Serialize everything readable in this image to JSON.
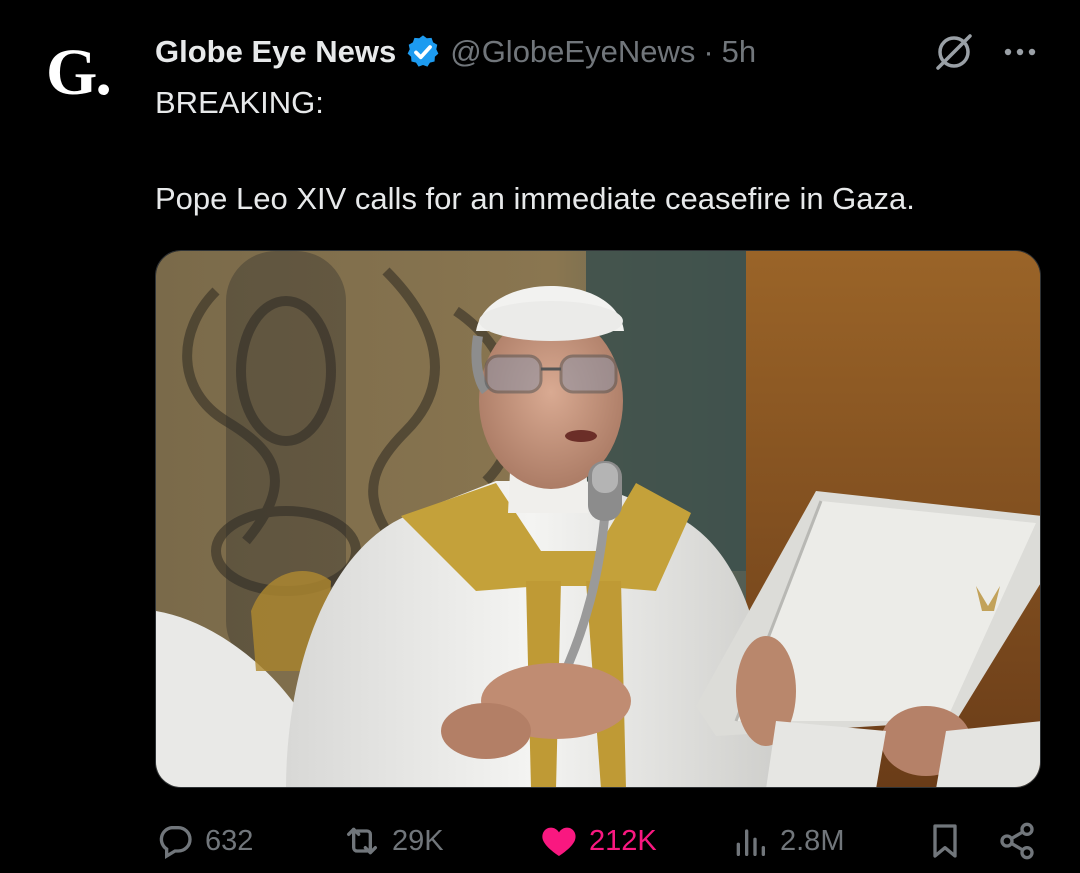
{
  "tweet": {
    "avatar_letter": "G.",
    "author_name": "Globe Eye News",
    "handle": "@GlobeEyeNews",
    "separator": "·",
    "time": "5h",
    "text_line1": "BREAKING:",
    "text_line2": "Pope Leo XIV calls for an immediate ceasefire in Gaza.",
    "media_icon": "photo-of-pope-speaking-into-microphone"
  },
  "actions": {
    "replies": "632",
    "retweets": "29K",
    "likes": "212K",
    "views": "2.8M"
  },
  "colors": {
    "background": "#000000",
    "text": "#e7e9ea",
    "muted": "#71767b",
    "verified": "#1d9bf0",
    "like": "#f91880"
  },
  "icons": [
    "verified-badge-icon",
    "grok-icon",
    "more-icon",
    "reply-icon",
    "retweet-icon",
    "heart-icon",
    "views-icon",
    "bookmark-icon",
    "share-icon"
  ]
}
